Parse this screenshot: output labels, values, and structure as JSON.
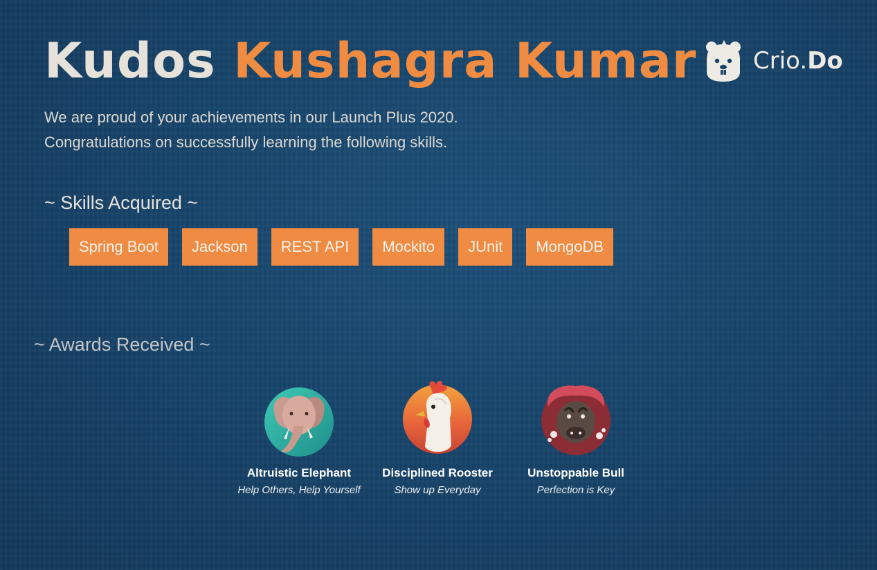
{
  "title": {
    "prefix": "Kudos",
    "name": "Kushagra Kumar"
  },
  "logo": {
    "icon": "beaver-icon",
    "text_light": "Crio.",
    "text_bold": "Do"
  },
  "intro": {
    "line1": "We are proud of your achievements in our Launch Plus 2020.",
    "line2": "Congratulations on successfully learning the following skills."
  },
  "skills": {
    "heading": "~ Skills Acquired ~",
    "items": [
      "Spring Boot",
      "Jackson",
      "REST API",
      "Mockito",
      "JUnit",
      "MongoDB"
    ]
  },
  "awards": {
    "heading": "~ Awards Received ~",
    "items": [
      {
        "name": "Altruistic Elephant",
        "tagline": "Help Others, Help Yourself",
        "icon": "elephant-icon"
      },
      {
        "name": "Disciplined Rooster",
        "tagline": "Show up Everyday",
        "icon": "rooster-icon"
      },
      {
        "name": "Unstoppable Bull",
        "tagline": "Perfection is Key",
        "icon": "bull-icon"
      }
    ]
  },
  "colors": {
    "background": "#17446b",
    "accent": "#ef8b43",
    "title_text": "#e6e1d9"
  }
}
